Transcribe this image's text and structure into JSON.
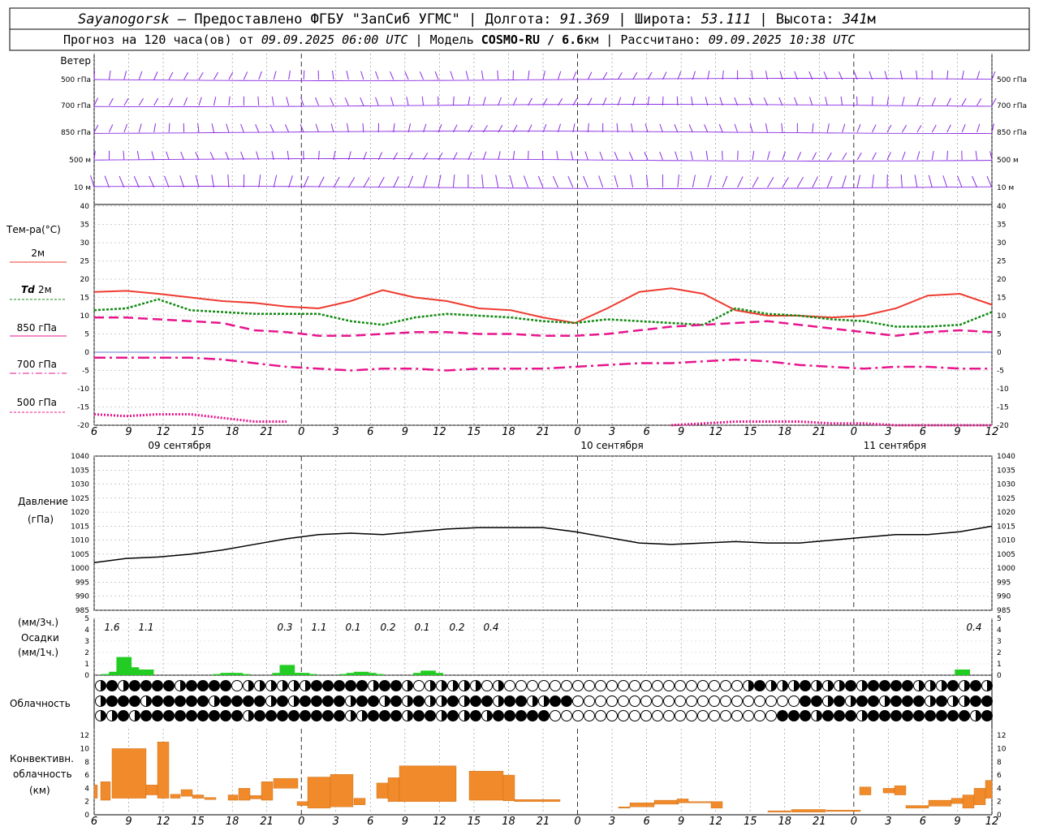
{
  "header": {
    "station": "Sayanogorsk",
    "dash": "—",
    "provider": "Предоставлено ФГБУ \"ЗапСиб УГМС\"",
    "lon_label": "Долгота:",
    "lon_value": "91.369",
    "lat_label": "Широта:",
    "lat_value": "53.111",
    "alt_label": "Высота:",
    "alt_value": "341",
    "alt_unit": "м",
    "forecast_prefix": "Прогноз на 120 часа(ов) от",
    "forecast_time": "09.09.2025 06:00 UTC",
    "model_prefix": "Модель",
    "model_name": "COSMO-RU / 6.6",
    "model_unit": "км",
    "calc_prefix": "Рассчитано:",
    "calc_time": "09.09.2025 10:38 UTC"
  },
  "labels": {
    "wind": "Ветер",
    "wind_levels": [
      "500 гПа",
      "700 гПа",
      "850 гПа",
      "500 м",
      "10  м"
    ],
    "temp": "Тем-ра(°C)",
    "t2m": "2м",
    "td_main": "Td",
    "td_sub": "2м",
    "t850": "850 гПа",
    "t700": "700 гПа",
    "t500": "500 гПа",
    "pressure": "Давление",
    "pressure_unit": "(гПа)",
    "precip_top": "(мм/3ч.)",
    "precip_mid": "Осадки",
    "precip_bot": "(мм/1ч.)",
    "cloud": "Облачность",
    "conv1": "Конвективн.",
    "conv2": "облачность",
    "conv3": "(км)",
    "day1": "09 сентября",
    "day2": "10 сентября",
    "day3": "11 сентября"
  },
  "colors": {
    "wind": "#8a2be2",
    "t2m": "#ee3b30",
    "td": "#138a13",
    "levels": "#e8148c",
    "precip": "#22cc22",
    "conv": "#f08a2a",
    "pressure": "#000000"
  },
  "chart_data": [
    {
      "type": "line",
      "x_hours": [
        "6",
        "9",
        "12",
        "15",
        "18",
        "21",
        "0",
        "3",
        "6",
        "9",
        "12",
        "15",
        "18",
        "21",
        "0",
        "3",
        "6",
        "9",
        "12",
        "15",
        "18",
        "21",
        "0",
        "3",
        "6",
        "9",
        "12"
      ],
      "ylim": [
        -20,
        40
      ],
      "yticks": [
        -20,
        -15,
        -10,
        -5,
        0,
        5,
        10,
        15,
        20,
        25,
        30,
        35,
        40
      ],
      "series": [
        {
          "name": "2м",
          "values": [
            16.5,
            16.8,
            16,
            15,
            14,
            13.5,
            12.5,
            12,
            14,
            17,
            15,
            14,
            12,
            11.5,
            9.5,
            8,
            12,
            16.5,
            17.5,
            16,
            11.5,
            10,
            10,
            9.5,
            10,
            12,
            15.5,
            16,
            13
          ]
        },
        {
          "name": "Td 2м",
          "values": [
            11.5,
            12,
            14.5,
            11.5,
            11,
            10.5,
            10.5,
            10.5,
            8.5,
            7.5,
            9.5,
            10.5,
            10,
            9.5,
            8.5,
            8,
            9,
            8.5,
            8,
            7.5,
            12,
            10.5,
            10,
            9,
            8.5,
            7,
            7,
            7.5,
            11
          ]
        },
        {
          "name": "850 гПа",
          "values": [
            9.5,
            9.5,
            9,
            8.5,
            8,
            6,
            5.5,
            4.5,
            4.5,
            5,
            5.5,
            5.5,
            5,
            5,
            4.5,
            4.5,
            5,
            6,
            7,
            7.5,
            8,
            8.5,
            7.5,
            6.5,
            5.5,
            4.5,
            5.5,
            6,
            5.5
          ]
        },
        {
          "name": "700 гПа",
          "values": [
            -1.5,
            -1.5,
            -1.5,
            -1.5,
            -2,
            -3,
            -4,
            -4.5,
            -5,
            -4.5,
            -4.5,
            -5,
            -4.5,
            -4.5,
            -4.5,
            -4,
            -3.5,
            -3,
            -3,
            -2.5,
            -2,
            -2.5,
            -3.5,
            -4,
            -4.5,
            -4,
            -4,
            -4.5,
            -4.5
          ]
        },
        {
          "name": "500 гПа",
          "values": [
            -17,
            -17.5,
            -17,
            -17,
            -18,
            -19,
            -19,
            null,
            null,
            null,
            null,
            null,
            null,
            null,
            null,
            null,
            null,
            null,
            -20,
            -19.5,
            -19,
            -19,
            -19,
            -19.5,
            -19.5,
            -20,
            -20,
            -20,
            -20
          ]
        }
      ]
    },
    {
      "type": "line",
      "ylim": [
        985,
        1040
      ],
      "yticks": [
        985,
        990,
        995,
        1000,
        1005,
        1010,
        1015,
        1020,
        1025,
        1030,
        1035,
        1040
      ],
      "series": [
        {
          "name": "",
          "values": [
            1002,
            1003.5,
            1004,
            1005,
            1006.5,
            1008.5,
            1010.5,
            1012,
            1012.5,
            1012,
            1013,
            1014,
            1014.5,
            1014.5,
            1014.5,
            1013,
            1011,
            1009,
            1008.5,
            1009,
            1009.5,
            1009,
            1009,
            1010,
            1011,
            1012,
            1012,
            1013,
            1015
          ]
        }
      ]
    },
    {
      "type": "bar",
      "ylim": [
        0,
        5
      ],
      "labels": [
        "1.6",
        "1.1",
        "0.3",
        "1.1",
        "0.1",
        "0.2",
        "0.1",
        "0.2",
        "0.4",
        "0.4"
      ],
      "hourly_series": [
        {
          "name": "",
          "values": [
            0.1,
            0.2,
            1.6,
            0.7,
            0.1,
            0.5,
            0.0,
            0.0,
            0.0,
            0.0,
            0.0,
            0.0,
            0.0,
            0.0,
            0.0,
            0.0,
            0.0,
            0.0,
            0.0,
            0.0,
            0.0,
            0.0,
            0.0,
            0.0,
            0.0,
            0.0,
            0.0,
            0.0,
            0.0,
            0.0,
            0.0,
            0.0,
            0.0,
            0.0,
            0.0,
            0.0,
            0.0,
            0.0,
            0.0,
            0.0,
            0.0,
            0.0,
            0.0,
            0.0,
            0.0,
            0.0,
            0.0,
            0.0,
            0.0,
            0.0,
            0.0,
            0.0,
            0.0,
            0.0,
            0.0,
            0.0,
            0.0,
            0.0,
            0.0,
            0.0,
            0.0,
            0.0,
            0.0,
            0.0,
            0.0,
            0.0,
            0.0,
            0.0,
            0.0,
            0.0,
            0.0,
            0.0,
            0.0,
            0.0,
            0.0,
            0.0,
            0.0,
            0.0,
            0.0,
            0.0,
            0.0,
            0.0,
            0.0,
            0.0,
            0.0,
            0.0,
            0.0,
            0.0,
            0.0,
            0.0,
            0.0,
            0.0,
            0.0,
            0.0,
            0.0,
            0.0,
            0.0,
            0.0,
            0.0,
            0.0,
            0.0,
            0.0,
            0.0,
            0.0,
            0.0,
            0.0,
            0.0,
            0.0,
            0.0,
            0.0,
            0.0,
            0.0,
            0.0,
            0.0,
            0.0,
            0.0,
            0.0,
            0.0,
            0.0,
            0.0,
            0.5
          ]
        }
      ]
    }
  ]
}
